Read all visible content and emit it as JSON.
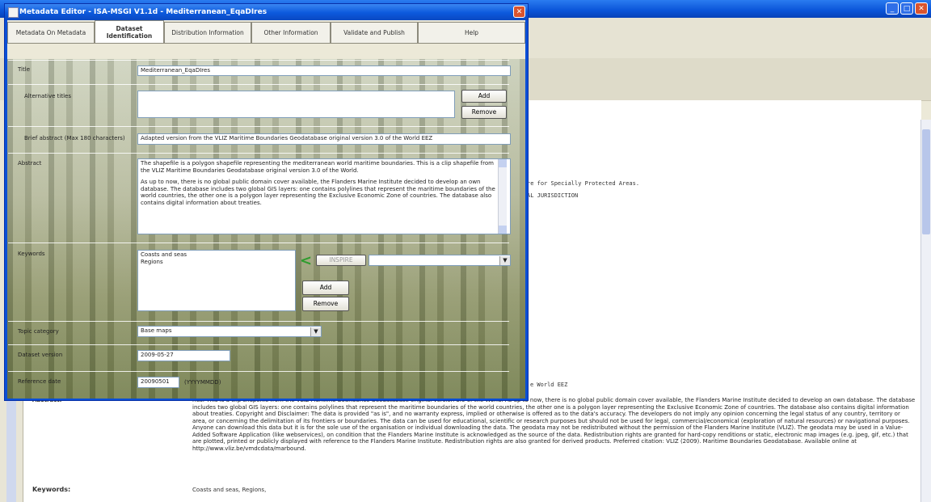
{
  "background": {
    "document_lines": [
      "re for Specially Protected Areas.",
      "AL JURISDICTION",
      "e World EEZ"
    ],
    "abstract_label": "Abstract:",
    "abstract_text": "ries. This is a clip shapefile from the VLIZ Maritime Boundaries Geodatabase original version 3.0 of the World. As up to now, there is no global public domain cover available, the Flanders Marine Institute decided to develop an own database. The database includes two global GIS layers: one contains polylines that represent the maritime boundaries of the world countries, the other one is a polygon layer representing the Exclusive Economic Zone of countries. The database also contains digital information about treaties. Copyright and Disclaimer: The data is provided \"as is\", and no warranty express, implied or otherwise is offered as to the data's accuracy. The developers do not imply any opinion concerning the legal status of any country, territory or area, or concerning the delimitation of its frontiers or boundaries. The data can be used for educational, scientific or research purposes but should not be used for legal, commercial/economical (exploration of natural resources) or navigational purposes. Anyone can download this data but it is for the sole use of the organisation or individual downloading the data. The geodata may not be redistributed without the permission of the Flanders Marine Institute (VLIZ). The geodata may be used in a Value-Added Software Application (like webservices), on condition that the Flanders Marine Institute is acknowledged as the source of the data. Redistribution rights are granted for hard-copy renditions or static, electronic map images (e.g. jpeg, gif, etc.) that are plotted, printed or publicly displayed with reference to the Flanders Marine Institute. Redistribution rights are also granted for derived products. Preferred citation: VLIZ (2009). Maritime Boundaries Geodatabase. Available online at http://www.vliz.be/vmdcdata/marbound.",
    "keywords_label": "Keywords:",
    "keywords_value": "Coasts and seas, Regions,"
  },
  "dialog": {
    "title": "Metadata Editor - ISA-MSGI V1.1d - Mediterranean_EqaDIres",
    "tabs": [
      {
        "label": "Metadata On Metadata"
      },
      {
        "label": "Dataset Identification"
      },
      {
        "label": "Distribution Information"
      },
      {
        "label": "Other Information"
      },
      {
        "label": "Validate and Publish"
      },
      {
        "label": "Help"
      }
    ],
    "fields": {
      "title_label": "Title",
      "title_value": "Mediterranean_EqaDIres",
      "alt_titles_label": "Alternative titles",
      "add_label": "Add",
      "remove_label": "Remove",
      "brief_abstract_label": "Brief abstract (Max 180 characters)",
      "brief_abstract_value": "Adapted version from the VLIZ Maritime Boundaries Geodatabase original version 3.0 of the World EEZ",
      "abstract_label": "Abstract",
      "abstract_p1": "The shapefile is a polygon shapefile representing the mediterranean world maritime boundaries. This is a clip shapefile from the VLIZ Maritime Boundaries Geodatabase original version 3.0 of the World.",
      "abstract_p2": "As up to now, there is no global public domain cover available, the Flanders Marine Institute decided to develop an own database. The database includes two global GIS layers: one contains polylines that represent the maritime boundaries of the world countries, the other one is a polygon layer representing the Exclusive Economic Zone of countries. The database also contains digital information about treaties.",
      "keywords_label": "Keywords",
      "keywords_list": [
        "Coasts and seas",
        "Regions"
      ],
      "keyword_button_label": "INSPIRE",
      "topic_label": "Topic category",
      "topic_value": "Base maps",
      "version_label": "Dataset version",
      "version_value": "2009-05-27",
      "refdate_label": "Reference date",
      "refdate_value": "20090501",
      "refdate_hint": "(YYYYMMDD)"
    }
  }
}
